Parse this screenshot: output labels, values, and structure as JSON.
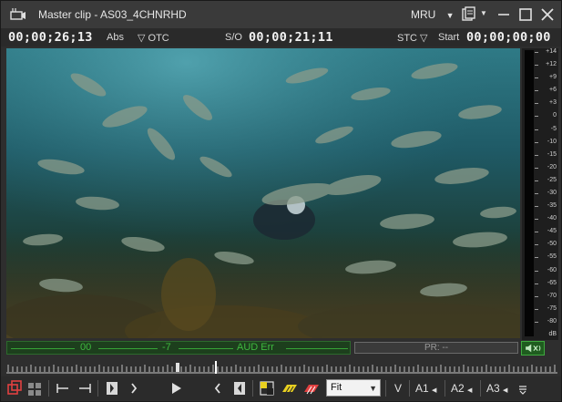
{
  "window": {
    "title": "Master clip - AS03_4CHNRHD",
    "mru_label": "MRU"
  },
  "timecodes": {
    "main_tc": "00;00;26;13",
    "main_mode": "Abs",
    "otc_label": "▽ OTC",
    "so_label": "S/O",
    "so_tc": "00;00;21;11",
    "stc_label": "STC ▽",
    "start_label": "Start",
    "start_tc": "00;00;00;00"
  },
  "meter": {
    "labels": [
      "+14",
      "+12",
      "+9",
      "+6",
      "+3",
      "0",
      "-5",
      "-10",
      "-15",
      "-20",
      "-25",
      "-30",
      "-35",
      "-40",
      "-45",
      "-50",
      "-55",
      "-60",
      "-65",
      "-70",
      "-75",
      "-80",
      "dB"
    ]
  },
  "status": {
    "green_left_text": "00",
    "green_mid_text": "-7",
    "green_right_text": "AUD Err",
    "pr_text": "PR: --"
  },
  "transport": {
    "fit_value": "Fit",
    "track_v": "V",
    "track_a1": "A1",
    "track_a2": "A2",
    "track_a3": "A3"
  },
  "colors": {
    "accent_green": "#3fb83f",
    "mark_red": "#e04040",
    "mark_yellow": "#e8d020"
  }
}
